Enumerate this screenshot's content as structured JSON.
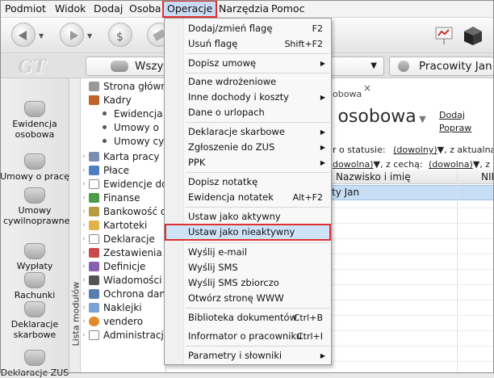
{
  "menubar": {
    "items": [
      "Podmiot",
      "Widok",
      "Dodaj",
      "Osoba",
      "Operacje",
      "Narzędzia",
      "Pomoc"
    ],
    "active": "Operacje"
  },
  "toolbar": {
    "icons": [
      "back-arrow-icon",
      "forward-arrow-icon",
      "money-bag-icon",
      "eraser-icon",
      "presentation-icon",
      "cube-icon"
    ]
  },
  "module_combo": "Wszy",
  "person_combo": "Pracowity Jan",
  "logo": "GT",
  "sidebar": {
    "items": [
      {
        "label": "Ewidencja osobowa",
        "icon": "people-icon"
      },
      {
        "label": "Umowy o pracę",
        "icon": "contract-icon"
      },
      {
        "label": "Umowy cywilnoprawne",
        "icon": "contract-icon"
      },
      {
        "label": "Wypłaty",
        "icon": "money-icon"
      },
      {
        "label": "Rachunki",
        "icon": "receipt-icon"
      },
      {
        "label": "Deklaracje skarbowe",
        "icon": "declaration-icon"
      },
      {
        "label": "Deklaracje ZUS",
        "icon": "zus-icon"
      }
    ]
  },
  "vertical_tab": "Lista modułów",
  "tree": {
    "items": [
      {
        "label": "Strona główna"
      },
      {
        "label": "Kadry"
      },
      {
        "label": "Ewidencja"
      },
      {
        "label": "Umowy o"
      },
      {
        "label": "Umowy cy"
      },
      {
        "label": "Karta pracy"
      },
      {
        "label": "Płace"
      },
      {
        "label": "Ewidencje doc"
      },
      {
        "label": "Finanse"
      },
      {
        "label": "Bankowość or"
      },
      {
        "label": "Kartoteki"
      },
      {
        "label": "Deklaracje"
      },
      {
        "label": "Zestawienia"
      },
      {
        "label": "Definicje"
      },
      {
        "label": "Wiadomości S"
      },
      {
        "label": "Ochrona dany"
      },
      {
        "label": "Naklejki"
      },
      {
        "label": "vendero"
      },
      {
        "label": "Administracja"
      }
    ]
  },
  "main": {
    "tab_label": "obowa",
    "title": "a osobowa",
    "links": [
      "Dodaj",
      "Popraw"
    ],
    "filter_status_label": "r o statusie:",
    "filter_status_value": "(dowolny)",
    "filter_status_rest": ", z aktualną u",
    "filter_row2_value": "dowolna)",
    "filter_row2_mid": ", z cechą:",
    "filter_row2_value2": "(dowolna)",
    "filter_row2_rest": ", z fl",
    "col_name": "Nazwisko i imię",
    "col_nip": "NIP",
    "selected_row": "ty Jan"
  },
  "dropdown": {
    "items": [
      {
        "label": "Dodaj/zmień flagę",
        "shortcut": "F2"
      },
      {
        "label": "Usuń flagę",
        "shortcut": "Shift+F2"
      },
      {
        "label": "Dopisz umowę",
        "submenu": "▶"
      },
      {
        "label": "Dane wdrożeniowe"
      },
      {
        "label": "Inne dochody i koszty",
        "submenu": "▶"
      },
      {
        "label": "Dane o urlopach"
      },
      {
        "label": "Deklaracje skarbowe",
        "submenu": "▶"
      },
      {
        "label": "Zgłoszenie do ZUS",
        "submenu": "▶"
      },
      {
        "label": "PPK",
        "submenu": "▶"
      },
      {
        "label": "Dopisz notatkę"
      },
      {
        "label": "Ewidencja notatek",
        "shortcut": "Alt+F2"
      },
      {
        "label": "Ustaw jako aktywny"
      },
      {
        "label": "Ustaw jako nieaktywny"
      },
      {
        "label": "Wyślij e-mail"
      },
      {
        "label": "Wyślij SMS"
      },
      {
        "label": "Wyślij SMS zbiorczo"
      },
      {
        "label": "Otwórz stronę WWW"
      },
      {
        "label": "Biblioteka dokumentów",
        "shortcut": "Ctrl+B"
      },
      {
        "label": "Informator o pracowniku",
        "shortcut": "Ctrl+I"
      },
      {
        "label": "Parametry i słowniki",
        "submenu": "▶"
      }
    ],
    "highlighted": "Ustaw jako nieaktywny"
  },
  "colors": {
    "highlight_border": "#e03030",
    "selection": "#c7def5"
  }
}
